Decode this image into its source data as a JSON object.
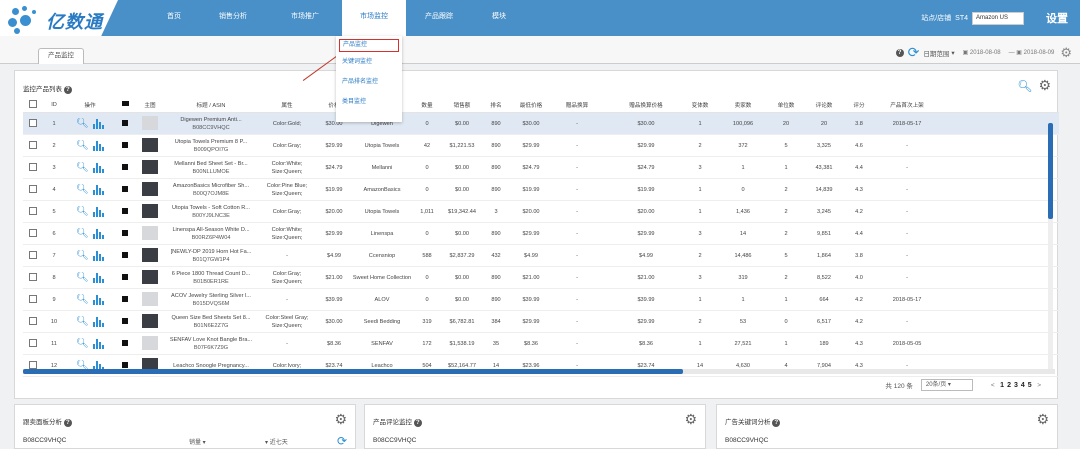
{
  "brand": {
    "name": "亿数通",
    "color": "#4a90c8"
  },
  "nav": {
    "items": [
      {
        "label": "首页",
        "active": false
      },
      {
        "label": "销售分析",
        "active": false
      },
      {
        "label": "市场推广",
        "active": false
      },
      {
        "label": "市场监控",
        "active": true
      },
      {
        "label": "产品跟踪",
        "active": false
      },
      {
        "label": "模块",
        "active": false
      }
    ],
    "user_label": "站点/店铺",
    "store_code": "ST4",
    "site": "Amazon US",
    "settings_label": "设置"
  },
  "dropdown": {
    "items": [
      {
        "label": "产品监控",
        "highlighted": true
      },
      {
        "label": "关键词监控",
        "highlighted": false
      },
      {
        "label": "产品排名监控",
        "highlighted": false
      },
      {
        "label": "类目监控",
        "highlighted": false
      }
    ]
  },
  "tab": {
    "label": "产品监控"
  },
  "date_filter": {
    "label": "日期范围",
    "start": "2018-08-08",
    "end": "2018-08-09"
  },
  "panel": {
    "title": "监控产品列表"
  },
  "table": {
    "columns": [
      "",
      "ID",
      "操作",
      "",
      "主图",
      "标题 / ASIN",
      "属性",
      "价格",
      "品牌",
      "数量",
      "销售额",
      "排名",
      "最低价格",
      "赠品换算",
      "",
      "赠品换算价格",
      "变体数",
      "卖家数",
      "单位数",
      "评论数",
      "评分",
      "产品首次上架"
    ],
    "rows": [
      [
        "1",
        "Digewen Premium Anti...",
        "B08CC9VHQC",
        "Color:Gold;",
        "$30.00",
        "Digewen",
        "0",
        "$0.00",
        "890",
        "$30.00",
        "-",
        "$30.00",
        "1",
        "100,096",
        "20",
        "20",
        "3.8",
        "2018-05-17",
        "light"
      ],
      [
        "2",
        "Utopia Towels Premium 8 P...",
        "B009QPOI7G",
        "Color:Gray;",
        "$29.99",
        "Utopia Towels",
        "42",
        "$1,221.53",
        "890",
        "$29.99",
        "-",
        "$29.99",
        "2",
        "372",
        "5",
        "3,325",
        "4.6",
        "-",
        "dark"
      ],
      [
        "3",
        "Mellanni Bed Sheet Set - Br...",
        "B00NLLUMOE",
        "Color:White; Size:Queen;",
        "$24.79",
        "Mellanni",
        "0",
        "$0.00",
        "890",
        "$24.79",
        "-",
        "$24.79",
        "3",
        "1",
        "1",
        "43,381",
        "4.4",
        "-",
        "dark"
      ],
      [
        "4",
        "AmazonBasics Microfiber Sh...",
        "B00Q7OJM8E",
        "Color:Pine Blue; Size:Queen;",
        "$19.99",
        "AmazonBasics",
        "0",
        "$0.00",
        "890",
        "$19.99",
        "-",
        "$19.99",
        "1",
        "0",
        "2",
        "14,839",
        "4.3",
        "-",
        "dark"
      ],
      [
        "5",
        "Utopia Towels - Soft Cotton R...",
        "B00YJ9LNC3E",
        "Color:Gray;",
        "$20.00",
        "Utopia Towels",
        "1,011",
        "$19,342.44",
        "3",
        "$20.00",
        "-",
        "$20.00",
        "1",
        "1,436",
        "2",
        "3,245",
        "4.2",
        "-",
        "dark"
      ],
      [
        "6",
        "Linenspa All-Season White D...",
        "B00RZ6P4W04",
        "Color:White; Size:Queen;",
        "$29.99",
        "Linenspa",
        "0",
        "$0.00",
        "890",
        "$29.99",
        "-",
        "$29.99",
        "3",
        "14",
        "2",
        "9,851",
        "4.4",
        "-",
        "light"
      ],
      [
        "7",
        "[NEWLY-DP 2019 Horn Hot Fa...",
        "B01Q7GW1P4",
        "-",
        "$4.99",
        "Ccensniop",
        "588",
        "$2,837.29",
        "432",
        "$4.99",
        "-",
        "$4.99",
        "2",
        "14,486",
        "5",
        "1,864",
        "3.8",
        "-",
        "dark"
      ],
      [
        "8",
        "6 Piece 1800 Thread Count D...",
        "B01B0ER1RE",
        "Color:Gray; Size:Queen;",
        "$21.00",
        "Sweet Home Collection",
        "0",
        "$0.00",
        "890",
        "$21.00",
        "-",
        "$21.00",
        "3",
        "319",
        "2",
        "8,522",
        "4.0",
        "-",
        "dark"
      ],
      [
        "9",
        "ACOV Jewelry Sterling Silver l...",
        "B015DVQS6M",
        "-",
        "$39.99",
        "ALOV",
        "0",
        "$0.00",
        "890",
        "$39.99",
        "-",
        "$39.99",
        "1",
        "1",
        "1",
        "664",
        "4.2",
        "2018-05-17",
        "light"
      ],
      [
        "10",
        "Queen Size Bed Sheets Set 8...",
        "B01N6E2Z7G",
        "Color:Steel Gray; Size:Queen;",
        "$30.00",
        "Seedi Bedding",
        "319",
        "$6,782.81",
        "384",
        "$29.99",
        "-",
        "$29.99",
        "2",
        "53",
        "0",
        "6,517",
        "4.2",
        "-",
        "dark"
      ],
      [
        "11",
        "SENFAV Love Knot Bangle Bra...",
        "B07F6K7Z9G",
        "-",
        "$8.36",
        "SENFAV",
        "172",
        "$1,538.19",
        "35",
        "$8.36",
        "-",
        "$8.36",
        "1",
        "27,521",
        "1",
        "189",
        "4.3",
        "2018-05-05",
        "light"
      ],
      [
        "12",
        "Leachco Snoogle Pregnancy...",
        "",
        "Color:Ivory;",
        "$23.74",
        "Leachco",
        "504",
        "$52,164.77",
        "14",
        "$23.96",
        "-",
        "$23.74",
        "14",
        "4,630",
        "4",
        "7,904",
        "4.3",
        "-",
        "dark"
      ]
    ]
  },
  "pager": {
    "total_label": "共 120 条",
    "per_page": "20条/页",
    "pages": [
      "1",
      "2",
      "3",
      "4",
      "5"
    ],
    "prev": "<",
    "next": ">"
  },
  "bottom": {
    "panels": [
      {
        "title": "跟卖面板分析",
        "asin": "B08CC9VHQC",
        "select1": "销量",
        "select2": "近七天"
      },
      {
        "title": "产品评论监控",
        "asin": "B08CC9VHQC"
      },
      {
        "title": "广告关键词分析",
        "asin": "B08CC9VHQC"
      }
    ]
  }
}
